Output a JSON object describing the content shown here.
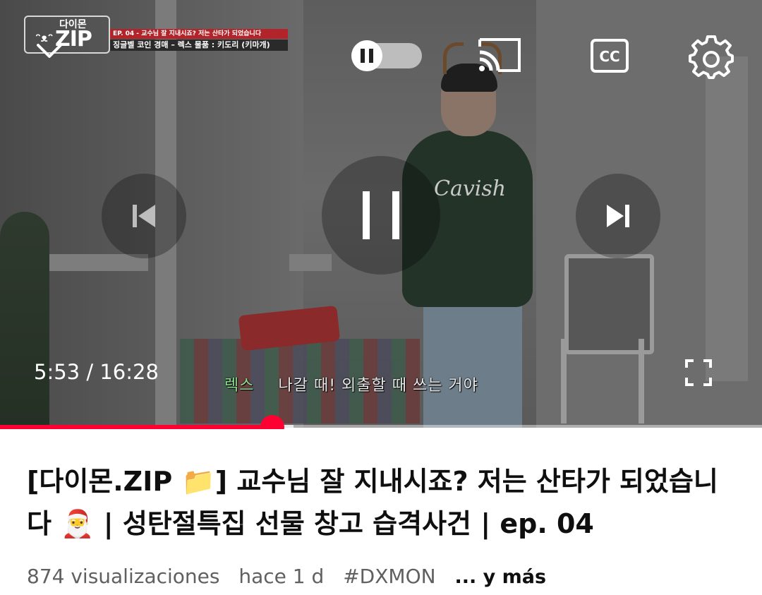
{
  "player": {
    "channel_logo": {
      "small_text": "다이몬",
      "big_text": "ZIP",
      "eyes": "ᵔᴥᵔ"
    },
    "episode_line": "EP. 04 - 교수님 잘 지내시죠? 저는 산타가 되었습니다",
    "segment_line": "징글벨 코인 경매 – 렉스 물품 : 키도리 (키마개)",
    "sweater_print": "Cavish",
    "current_time": "5:53",
    "time_separator": " / ",
    "duration": "16:28",
    "progress_fraction": 0.3573,
    "subtitle_speaker": "렉스",
    "subtitle_text": "나갈 때! 외출할 때 쓰는 거야",
    "icons": {
      "collapse": "chevron-down-icon",
      "autoplay": "autoplay-toggle-icon",
      "cast": "cast-icon",
      "captions": "cc-icon",
      "settings": "gear-icon",
      "previous": "skip-previous-icon",
      "play_pause": "pause-icon",
      "next": "skip-next-icon",
      "fullscreen": "fullscreen-icon"
    },
    "colors": {
      "accent": "#ff0033",
      "subtitle_speaker": "#8fd88f"
    }
  },
  "video": {
    "title": "[다이몬.ZIP 📁] 교수님 잘 지내시죠? 저는 산타가 되었습니다 🎅 | 성탄절특집 선물 창고 습격사건 | ep. 04",
    "views": "874 visualizaciones",
    "age": "hace 1 d",
    "hashtag": "#DXMON",
    "more_label": "... y más"
  }
}
